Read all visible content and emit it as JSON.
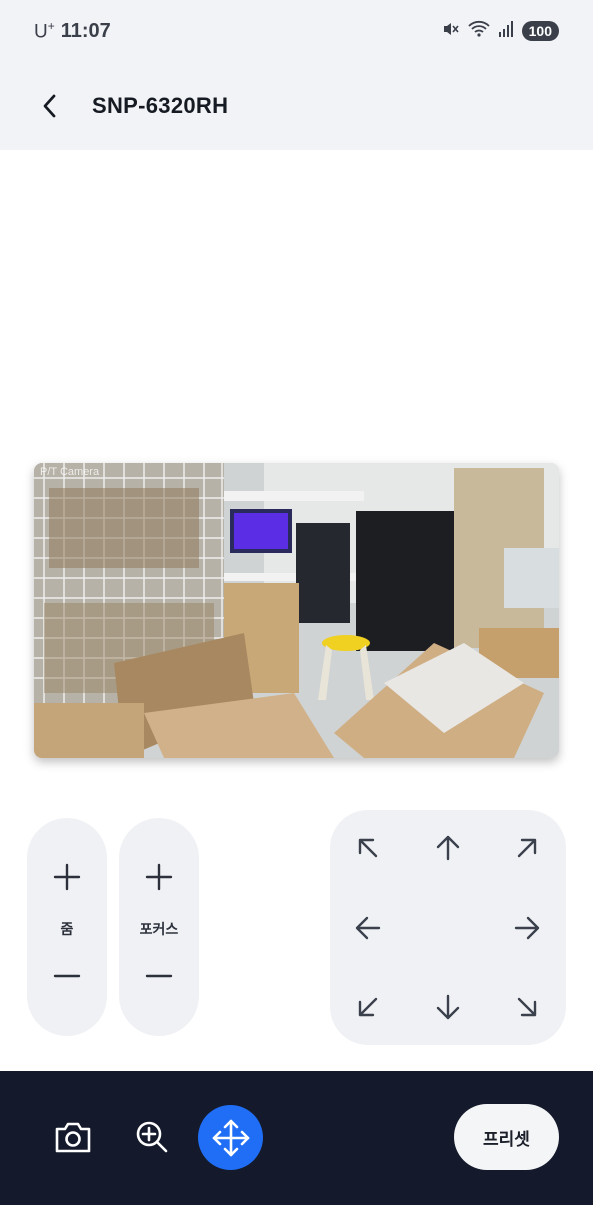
{
  "status_bar": {
    "carrier": "U",
    "carrier_sup": "+",
    "time": "11:07",
    "battery": "100",
    "icons": [
      "mute-icon",
      "wifi-icon",
      "signal-icon"
    ]
  },
  "app_bar": {
    "back_icon": "chevron-left-icon",
    "title": "SNP-6320RH"
  },
  "camera": {
    "overlay_text": "P/T Camera"
  },
  "zoom": {
    "label": "줌",
    "plus_icon": "plus-icon",
    "minus_icon": "minus-icon"
  },
  "focus": {
    "label": "포커스",
    "plus_icon": "plus-icon",
    "minus_icon": "minus-icon"
  },
  "dpad": {
    "icons": [
      "arrow-up-left-icon",
      "arrow-up-icon",
      "arrow-up-right-icon",
      "arrow-left-icon",
      "arrow-right-icon",
      "arrow-down-left-icon",
      "arrow-down-icon",
      "arrow-down-right-icon"
    ]
  },
  "bottom_bar": {
    "snapshot_icon": "camera-icon",
    "digital_zoom_icon": "zoom-in-icon",
    "ptz_icon": "move-icon",
    "preset_label": "프리셋",
    "ptz_color": "#1f6ef5",
    "background": "#141a2b"
  }
}
